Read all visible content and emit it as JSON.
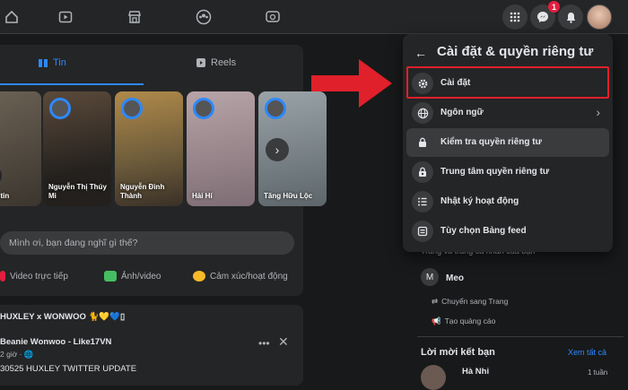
{
  "topbar": {
    "nav_icons": [
      "home-icon",
      "video-icon",
      "marketplace-icon",
      "groups-icon",
      "gaming-icon"
    ],
    "messenger_badge": "1"
  },
  "feed": {
    "tabs": [
      {
        "label": "Tin",
        "icon": "book-icon"
      },
      {
        "label": "Reels",
        "icon": "reels-icon"
      }
    ],
    "stories": [
      {
        "name": "Tạo tin"
      },
      {
        "name": "Nguyễn Thị Thúy Mi"
      },
      {
        "name": "Nguyễn Đình Thành"
      },
      {
        "name": "Hải Hí"
      },
      {
        "name": "Tăng Hữu Lộc"
      }
    ],
    "composer": {
      "placeholder": "Mình ơi, bạn đang nghĩ gì thế?",
      "actions": [
        "Video trực tiếp",
        "Ảnh/video",
        "Cảm xúc/hoạt động"
      ]
    },
    "post": {
      "group": "HUXLEY x WONWOO 🐈💛💙▯",
      "author": "Beanie Wonwoo - Like17VN",
      "time": "2 giờ · 🌐",
      "text": "30525 HUXLEY TWITTER UPDATE"
    }
  },
  "right_column": {
    "pages_heading": "Trang và trang cá nhân của bạn",
    "page_name": "Meo",
    "page_avatar": "M",
    "switch_label": "Chuyển sang Trang",
    "ads_label": "Tạo quảng cáo",
    "requests_heading": "Lời mời kết bạn",
    "see_all": "Xem tất cả",
    "friend_name": "Hà Nhi",
    "friend_time": "1 tuần"
  },
  "menu": {
    "title": "Cài đặt & quyền riêng tư",
    "items": [
      {
        "label": "Cài đặt",
        "icon": "gear-icon"
      },
      {
        "label": "Ngôn ngữ",
        "icon": "globe-icon"
      },
      {
        "label": "Kiểm tra quyền riêng tư",
        "icon": "lock-icon"
      },
      {
        "label": "Trung tâm quyền riêng tư",
        "icon": "lock-person-icon"
      },
      {
        "label": "Nhật ký hoạt động",
        "icon": "list-icon"
      },
      {
        "label": "Tùy chọn Bảng feed",
        "icon": "feed-icon"
      }
    ]
  },
  "colors": {
    "accent": "#2d88ff",
    "annotation": "#e0202a"
  }
}
